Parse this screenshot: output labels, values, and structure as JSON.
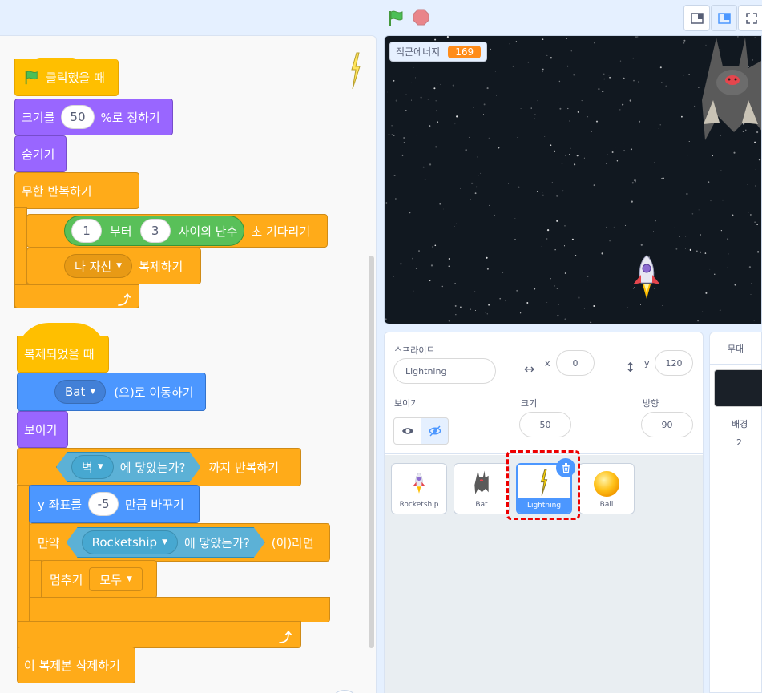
{
  "colors": {
    "events": "#ffbf00",
    "looks": "#9966ff",
    "control": "#ffab19",
    "motion": "#4c97ff",
    "sensing": "#5cb1d6",
    "operator": "#59c059",
    "highlight": "#e00000"
  },
  "topbar": {
    "flag_icon": "green-flag-icon",
    "stop_icon": "stop-icon"
  },
  "script1": {
    "hat": "클릭했을 때",
    "set_size_prefix": "크기를",
    "set_size_value": "50",
    "set_size_suffix": "%로 정하기",
    "hide": "숨기기",
    "forever": "무한 반복하기",
    "wait_from": "1",
    "wait_from_label": "부터",
    "wait_to": "3",
    "wait_random": "사이의 난수",
    "wait_suffix": "초 기다리기",
    "clone_target": "나 자신",
    "clone_suffix": "복제하기"
  },
  "script2": {
    "hat": "복제되었을 때",
    "goto_target": "Bat",
    "goto_suffix": "(으)로 이동하기",
    "show": "보이기",
    "touching_target": "벽",
    "touching_label": "에 닿았는가?",
    "repeat_until_suffix": "까지 반복하기",
    "change_y_prefix": "y 좌표를",
    "change_y_value": "-5",
    "change_y_suffix": "만큼 바꾸기",
    "if_label": "만약",
    "if_target": "Rocketship",
    "if_touching": "에 닿았는가?",
    "if_suffix": "(이)라면",
    "stop_label": "멈추기",
    "stop_option": "모두",
    "delete_clone": "이 복제본 삭제하기"
  },
  "stage": {
    "monitor_label": "적군에너지",
    "monitor_value": "169"
  },
  "sprite_info": {
    "sprite_label": "스프라이트",
    "sprite_name": "Lightning",
    "x_label": "x",
    "x_value": "0",
    "y_label": "y",
    "y_value": "120",
    "show_label": "보이기",
    "size_label": "크기",
    "size_value": "50",
    "direction_label": "방향",
    "direction_value": "90"
  },
  "sprites": [
    "Rocketship",
    "Bat",
    "Lightning",
    "Ball"
  ],
  "stage_pane": {
    "header": "무대",
    "backdrop_label": "배경",
    "backdrop_count": "2"
  }
}
